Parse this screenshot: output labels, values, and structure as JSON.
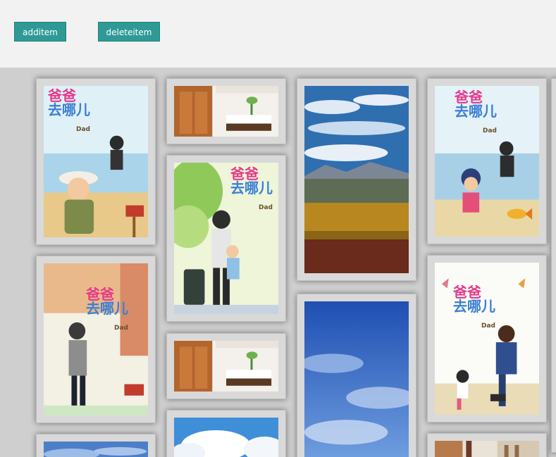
{
  "toolbar": {
    "add_label": "additem",
    "delete_label": "deleteitem"
  },
  "poster_text": {
    "line1": "爸爸",
    "line2": "去哪儿",
    "dad": "Dad"
  },
  "colors": {
    "button_bg": "#2f9a95",
    "button_text": "#ffffff",
    "toolbar_bg": "#f2f2f2",
    "wall_bg": "#cfcfcf",
    "card_bg": "#d9d9d9"
  },
  "cards": [
    {
      "column": 1,
      "kind": "poster-boy-hat"
    },
    {
      "column": 1,
      "kind": "poster-dad-carry"
    },
    {
      "column": 1,
      "kind": "sky"
    },
    {
      "column": 2,
      "kind": "bedroom"
    },
    {
      "column": 2,
      "kind": "poster-dad-suitcase"
    },
    {
      "column": 2,
      "kind": "bedroom"
    },
    {
      "column": 2,
      "kind": "sky-clouds"
    },
    {
      "column": 3,
      "kind": "city-wall"
    },
    {
      "column": 3,
      "kind": "blue-sky"
    },
    {
      "column": 4,
      "kind": "poster-girl-fish"
    },
    {
      "column": 4,
      "kind": "poster-dad-kneel"
    },
    {
      "column": 4,
      "kind": "interior"
    }
  ]
}
